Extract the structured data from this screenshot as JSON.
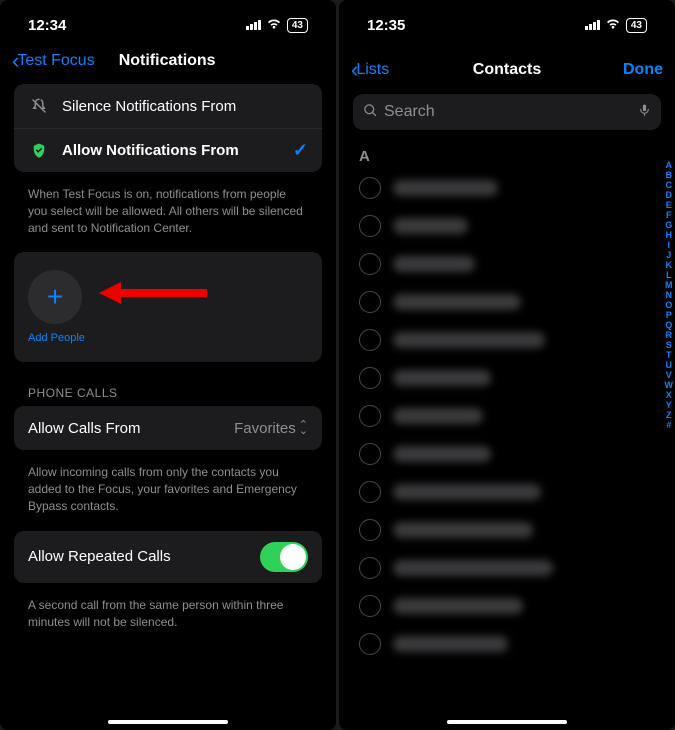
{
  "left": {
    "status": {
      "time": "12:34",
      "battery": "43"
    },
    "nav": {
      "back": "Test Focus",
      "title": "Notifications"
    },
    "silence_row": {
      "label": "Silence Notifications From"
    },
    "allow_row": {
      "label": "Allow Notifications From"
    },
    "desc1": "When Test Focus is on, notifications from people you select will be allowed. All others will be silenced and sent to Notification Center.",
    "add": {
      "label": "Add People"
    },
    "phone_calls_header": "PHONE CALLS",
    "calls_from": {
      "label": "Allow Calls From",
      "value": "Favorites"
    },
    "desc2": "Allow incoming calls from only the contacts you added to the Focus, your favorites and Emergency Bypass contacts.",
    "repeated": {
      "label": "Allow Repeated Calls",
      "on": true
    },
    "desc3": "A second call from the same person within three minutes will not be silenced."
  },
  "right": {
    "status": {
      "time": "12:35",
      "battery": "43"
    },
    "nav": {
      "back": "Lists",
      "title": "Contacts",
      "done": "Done"
    },
    "search": {
      "placeholder": "Search"
    },
    "section": "A",
    "contacts_blur_widths": [
      105,
      75,
      82,
      128,
      152,
      98,
      90,
      98,
      148,
      140,
      160,
      130,
      115
    ],
    "index": [
      "A",
      "B",
      "C",
      "D",
      "E",
      "F",
      "G",
      "H",
      "I",
      "J",
      "K",
      "L",
      "M",
      "N",
      "O",
      "P",
      "Q",
      "R",
      "S",
      "T",
      "U",
      "V",
      "W",
      "X",
      "Y",
      "Z",
      "#"
    ]
  }
}
